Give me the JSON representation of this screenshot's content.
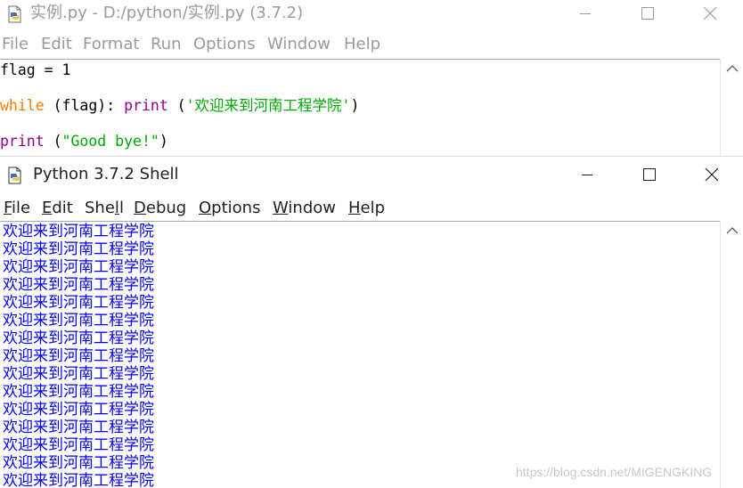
{
  "editor": {
    "title": "实例.py - D:/python/实例.py (3.7.2)",
    "menu": [
      "File",
      "Edit",
      "Format",
      "Run",
      "Options",
      "Window",
      "Help"
    ],
    "code": {
      "line1": "flag = 1",
      "line2": {
        "kw": "while",
        "mid": " (flag): ",
        "fn": "print",
        "sp": " (",
        "str": "'欢迎来到河南工程学院'",
        "end": ")"
      },
      "line3": {
        "fn": "print",
        "sp": " (",
        "str": "\"Good bye!\"",
        "end": ")"
      }
    }
  },
  "shell": {
    "title": "Python 3.7.2 Shell",
    "menu": [
      {
        "u": "F",
        "rest": "ile"
      },
      {
        "u": "E",
        "rest": "dit"
      },
      {
        "pre": "She",
        "u": "l",
        "rest": "l"
      },
      {
        "u": "D",
        "rest": "ebug"
      },
      {
        "u": "O",
        "rest": "ptions"
      },
      {
        "u": "W",
        "rest": "indow"
      },
      {
        "u": "H",
        "rest": "elp"
      }
    ],
    "output_text": "欢迎来到河南工程学院",
    "output_lines": [
      "欢迎来到河南工程学院",
      "欢迎来到河南工程学院",
      "欢迎来到河南工程学院",
      "欢迎来到河南工程学院",
      "欢迎来到河南工程学院",
      "欢迎来到河南工程学院",
      "欢迎来到河南工程学院",
      "欢迎来到河南工程学院",
      "欢迎来到河南工程学院",
      "欢迎来到河南工程学院",
      "欢迎来到河南工程学院",
      "欢迎来到河南工程学院",
      "欢迎来到河南工程学院",
      "欢迎来到河南工程学院",
      "欢迎来到河南工程学院"
    ]
  },
  "watermark": "https://blog.csdn.net/MIGENGKING",
  "icons": {
    "app": "python-file-icon",
    "minimize": "minimize-icon",
    "maximize": "maximize-icon",
    "close": "close-icon",
    "scroll_up": "scroll-up-arrow-icon"
  },
  "colors": {
    "keyword": "#ff7700",
    "builtin": "#900090",
    "string": "#00aa00",
    "shell_output": "#0000ff"
  }
}
